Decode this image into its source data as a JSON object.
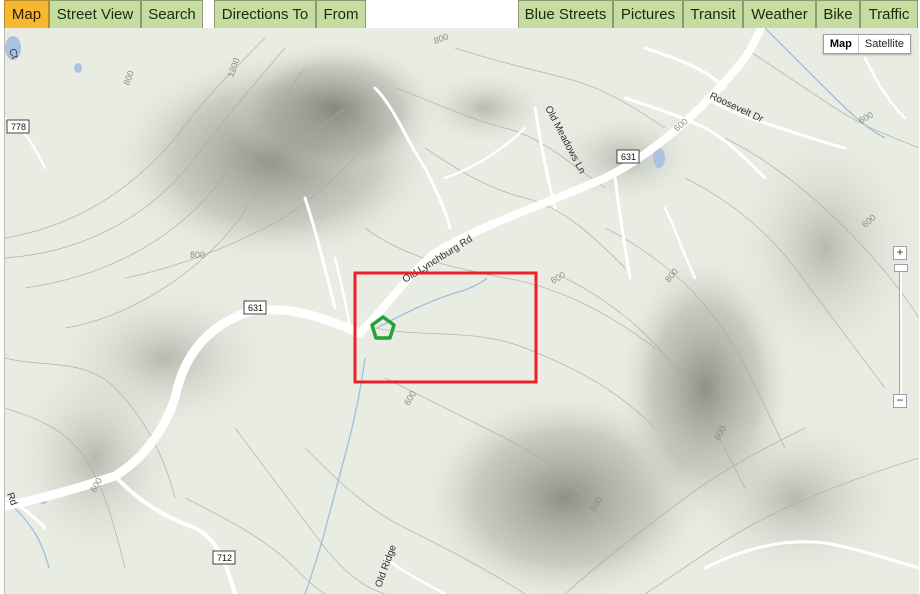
{
  "tabs_left": [
    {
      "label": "Map",
      "active": true
    },
    {
      "label": "Street View",
      "active": false
    },
    {
      "label": "Search",
      "active": false
    },
    {
      "label": "Directions To",
      "active": false
    },
    {
      "label": "From",
      "active": false
    }
  ],
  "tabs_right": [
    {
      "label": "Blue Streets"
    },
    {
      "label": "Pictures"
    },
    {
      "label": "Transit"
    },
    {
      "label": "Weather"
    },
    {
      "label": "Bike"
    },
    {
      "label": "Traffic"
    }
  ],
  "map_type": {
    "map_label": "Map",
    "satellite_label": "Satellite",
    "selected": "Map"
  },
  "zoom": {
    "plus": "+",
    "minus": "−"
  },
  "roads": {
    "old_lynchburg": "Old Lynchburg Rd",
    "old_meadows": "Old Meadows Ln",
    "roosevelt": "Roosevelt Dr",
    "old_ridge": "Old Ridge",
    "ct_fragment": "Ct",
    "rd_fragment": "Rd"
  },
  "shields": {
    "s631_west": "631",
    "s631_east": "631",
    "s778": "778",
    "s712": "712"
  },
  "contours": {
    "c800_a": "800",
    "c800_b": "800",
    "c800_c": "800",
    "c1200": "1200",
    "c600_a": "600",
    "c600_b": "600",
    "c600_c": "600",
    "c600_d": "600",
    "c600_e": "600",
    "c600_f": "600",
    "c600_g": "600",
    "c600_h": "600",
    "c800_d": "800"
  },
  "colors": {
    "active_tab": "#f5b830",
    "tab": "#c6dca0",
    "highlight_box": "#e8222a",
    "marker": "#22a23a",
    "water": "#a9c3e0",
    "terrain": "#e9ece3"
  }
}
